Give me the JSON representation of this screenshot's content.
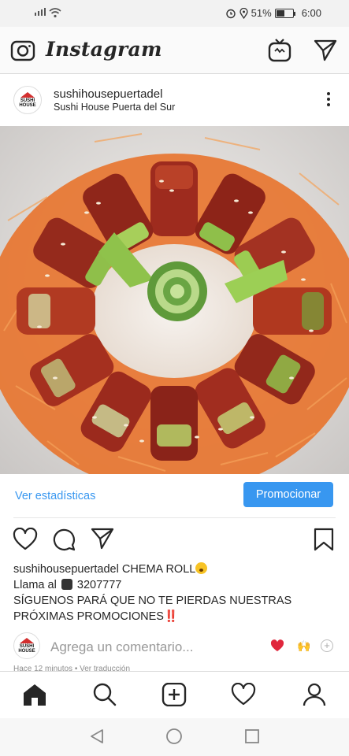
{
  "status_bar": {
    "battery_percent": "51%",
    "battery_level": 0.51,
    "time": "6:00",
    "icons": [
      "signal-icon",
      "wifi-icon",
      "alarm-icon",
      "location-icon",
      "battery-icon"
    ]
  },
  "header": {
    "app_title": "Instagram",
    "icons": [
      "camera-icon",
      "igtv-icon",
      "direct-message-icon"
    ]
  },
  "post": {
    "username": "sushihousepuertadel",
    "location": "Sushi House Puerta del Sur",
    "avatar_text": "SUSHI HOUSE",
    "image_alt": "sushi-roll-photo"
  },
  "insights": {
    "view_stats_label": "Ver estadísticas",
    "promote_label": "Promocionar"
  },
  "caption": {
    "username": "sushihousepuertadel",
    "line1_text": "CHEMA ROLL",
    "line2_prefix": "Llama al",
    "phone_number": "3207777",
    "line3_text": "SÍGUENOS PARÁ QUE NO TE PIERDAS NUESTRAS PRÓXIMAS PROMOCIONES",
    "line3_suffix": "‼️"
  },
  "comment": {
    "placeholder": "Agrega un comentario...",
    "quick_reactions": [
      "heart-emoji",
      "raised-hands-emoji",
      "add-reaction-icon"
    ]
  },
  "meta": {
    "time_ago": "Hace 12 minutos",
    "separator": " • ",
    "translate_label": "Ver traducción"
  },
  "bottom_nav": [
    "home-icon",
    "search-icon",
    "new-post-icon",
    "activity-icon",
    "profile-icon"
  ],
  "android_nav": [
    "back-icon",
    "home-circle-icon",
    "recents-icon"
  ],
  "colors": {
    "accent_blue": "#3897f0",
    "text": "#262626",
    "muted": "#8e8e8e"
  }
}
